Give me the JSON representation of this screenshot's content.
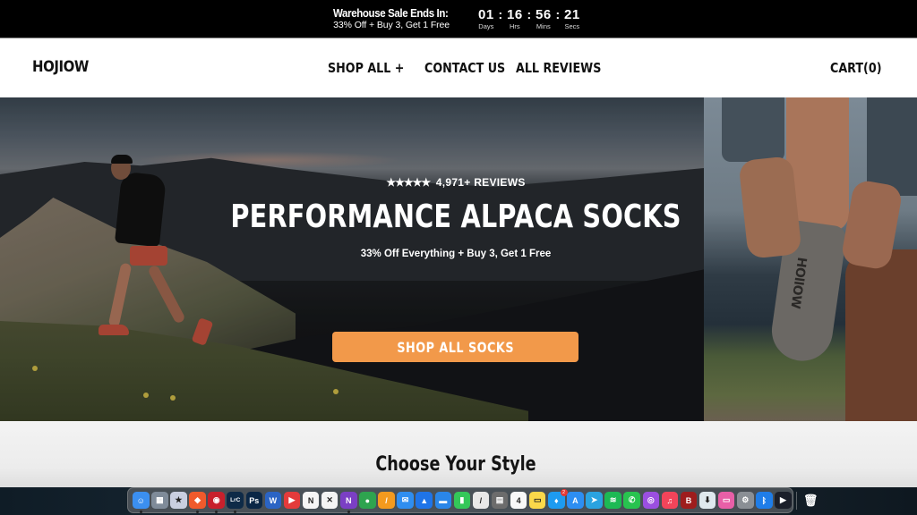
{
  "promo_bar": {
    "title": "Warehouse Sale Ends In:",
    "subtitle": "33% Off + Buy 3, Get 1 Free",
    "countdown": [
      {
        "value": "01",
        "label": "Days"
      },
      {
        "value": "16",
        "label": "Hrs"
      },
      {
        "value": "56",
        "label": "Mins"
      },
      {
        "value": "21",
        "label": "Secs"
      }
    ],
    "separator": ":"
  },
  "header": {
    "logo": "HOJIOW",
    "nav": [
      {
        "label": "SHOP ALL +"
      },
      {
        "label": "CONTACT US"
      },
      {
        "label": "ALL REVIEWS"
      }
    ],
    "cart_label": "CART(0)"
  },
  "hero": {
    "stars": "★★★★★",
    "rating_text": "4,971+ REVIEWS",
    "title": "PERFORMANCE ALPACA SOCKS",
    "subtitle": "33% Off Everything + Buy 3, Get 1 Free",
    "cta_label": "SHOP ALL SOCKS",
    "sock_brand": "HOllOW",
    "accent_color": "#f2994a"
  },
  "section": {
    "title": "Choose Your Style"
  },
  "dock": {
    "apps": [
      {
        "name": "Finder",
        "glyph": "☺",
        "color": "#3b8ff0",
        "running": true
      },
      {
        "name": "Launchpad",
        "glyph": "▦",
        "color": "#7f8b99",
        "running": false
      },
      {
        "name": "Superstar",
        "glyph": "★",
        "color": "#c9cfe0",
        "running": false
      },
      {
        "name": "Brave",
        "glyph": "◆",
        "color": "#ef5a2c",
        "running": true
      },
      {
        "name": "Screen Recorder",
        "glyph": "◉",
        "color": "#c8202c",
        "running": true
      },
      {
        "name": "Lightroom Classic",
        "glyph": "LrC",
        "color": "#0e2a47",
        "running": true
      },
      {
        "name": "Photoshop",
        "glyph": "Ps",
        "color": "#0b2746",
        "running": false
      },
      {
        "name": "Microsoft Word",
        "glyph": "W",
        "color": "#2b64c4",
        "running": false
      },
      {
        "name": "Presentation Tool",
        "glyph": "▶",
        "color": "#e33b3b",
        "running": false
      },
      {
        "name": "Notion",
        "glyph": "N",
        "color": "#f6f6f6",
        "running": false
      },
      {
        "name": "CapCut",
        "glyph": "✕",
        "color": "#f4f4f4",
        "running": false
      },
      {
        "name": "OneNote",
        "glyph": "N",
        "color": "#7b3fc4",
        "running": true
      },
      {
        "name": "Evernote",
        "glyph": "●",
        "color": "#2ea44f",
        "running": false
      },
      {
        "name": "Pages",
        "glyph": "/",
        "color": "#f39a1e",
        "running": false
      },
      {
        "name": "Mail",
        "glyph": "✉",
        "color": "#2f8ef0",
        "running": false
      },
      {
        "name": "Spark",
        "glyph": "▲",
        "color": "#1f74e8",
        "running": false
      },
      {
        "name": "Keynote",
        "glyph": "▬",
        "color": "#2a86e8",
        "running": false
      },
      {
        "name": "Numbers",
        "glyph": "▮",
        "color": "#34c759",
        "running": false
      },
      {
        "name": "Markup",
        "glyph": "/",
        "color": "#e8e8e8",
        "running": false
      },
      {
        "name": "Calculator",
        "glyph": "▤",
        "color": "#6c6c6c",
        "running": false
      },
      {
        "name": "Calendar",
        "glyph": "4",
        "color": "#f8f8f8",
        "running": false
      },
      {
        "name": "Notes",
        "glyph": "▭",
        "color": "#fbd84a",
        "running": false
      },
      {
        "name": "Twitter",
        "glyph": "♦",
        "color": "#1d9bf0",
        "running": false,
        "badge": "2"
      },
      {
        "name": "App Store",
        "glyph": "A",
        "color": "#2d8ef2",
        "running": false
      },
      {
        "name": "Telegram",
        "glyph": "➤",
        "color": "#2aa3e0",
        "running": false
      },
      {
        "name": "Spotify",
        "glyph": "≋",
        "color": "#1db954",
        "running": false
      },
      {
        "name": "WhatsApp",
        "glyph": "✆",
        "color": "#28c34f",
        "running": false
      },
      {
        "name": "Podcasts",
        "glyph": "◎",
        "color": "#9b4fe0",
        "running": false
      },
      {
        "name": "Music",
        "glyph": "♫",
        "color": "#f2445a",
        "running": false
      },
      {
        "name": "Bear",
        "glyph": "B",
        "color": "#9e1d1d",
        "running": false
      },
      {
        "name": "Downie",
        "glyph": "⬇",
        "color": "#dfe9ee",
        "running": false
      },
      {
        "name": "Screens",
        "glyph": "▭",
        "color": "#e85fa7",
        "running": false
      },
      {
        "name": "System Preferences",
        "glyph": "⚙",
        "color": "#8a8f95",
        "running": false
      },
      {
        "name": "Bluetooth",
        "glyph": "ᛒ",
        "color": "#1f7de8",
        "running": false
      },
      {
        "name": "Infuse",
        "glyph": "▶",
        "color": "#1b1f2a",
        "running": false
      }
    ],
    "trash": {
      "name": "Trash",
      "glyph": "🗑"
    }
  }
}
